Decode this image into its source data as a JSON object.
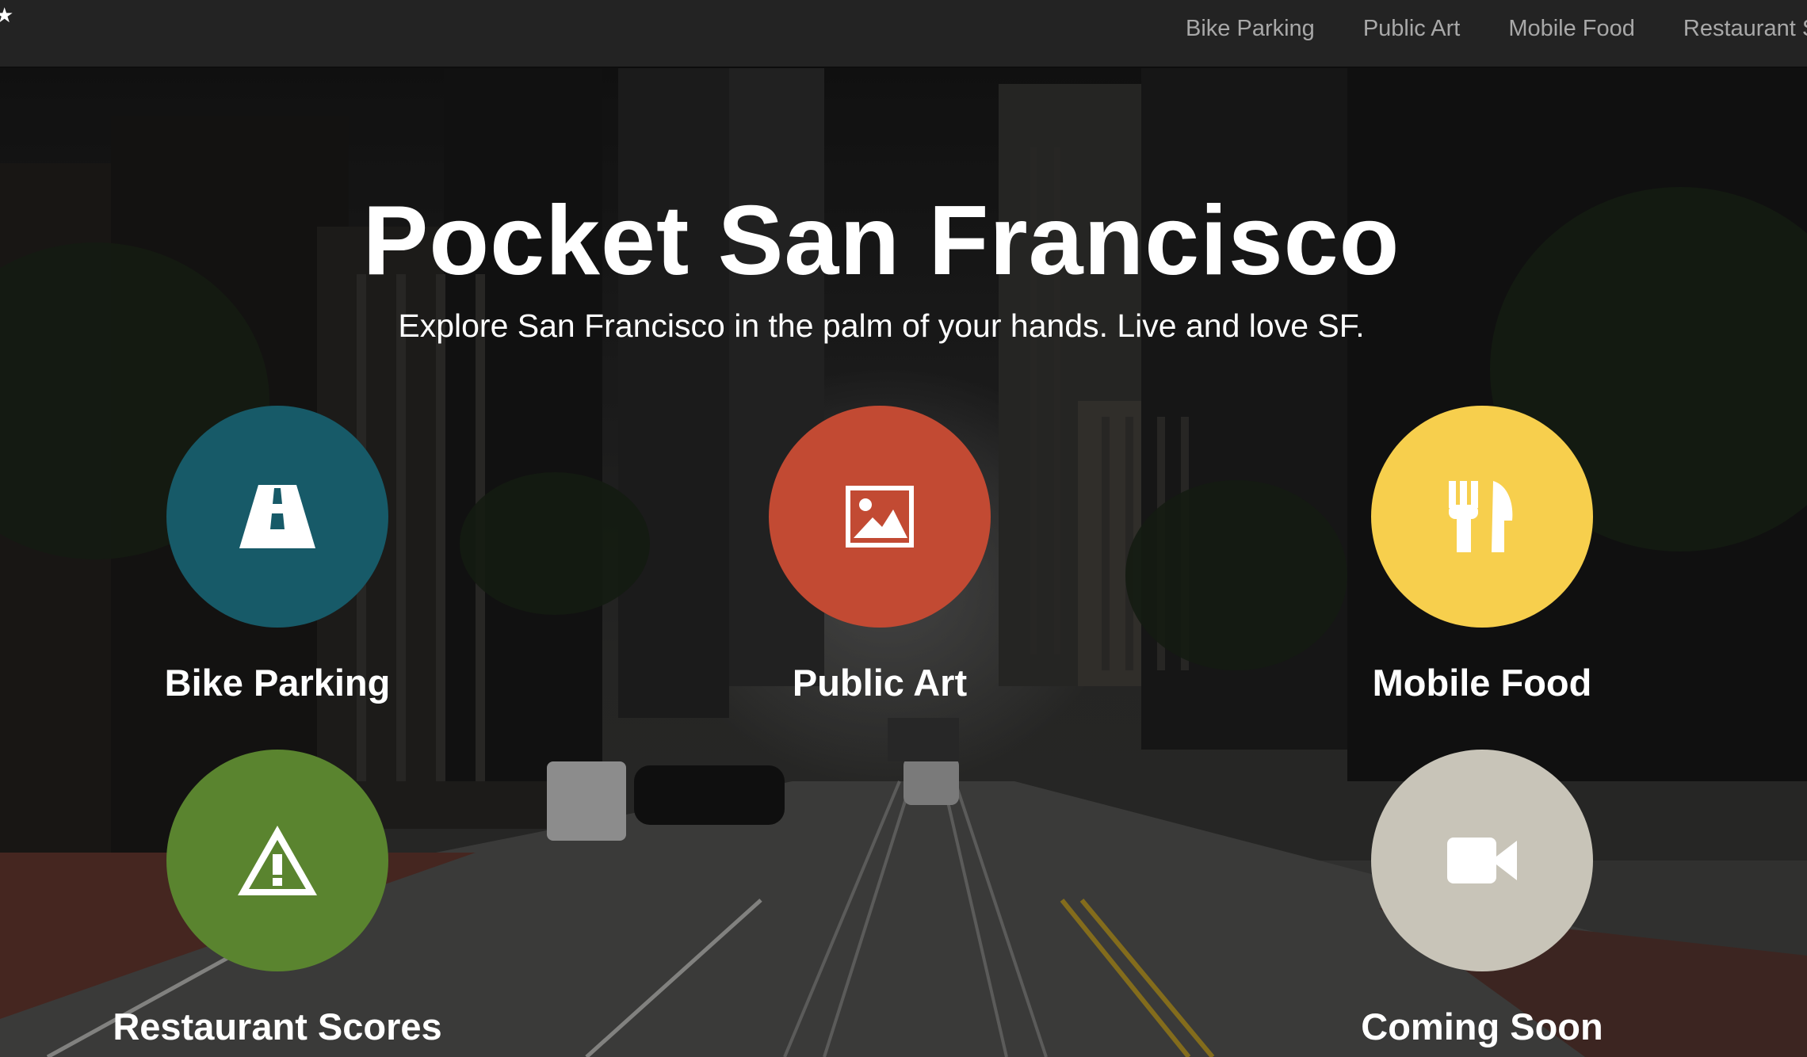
{
  "nav": {
    "links": [
      "Bike Parking",
      "Public Art",
      "Mobile Food",
      "Restaurant Scores"
    ]
  },
  "hero": {
    "title": "Pocket San Francisco",
    "subtitle": "Explore San Francisco in the palm of your hands. Live and love SF."
  },
  "tiles": [
    {
      "label": "Bike Parking",
      "color": "#175a68",
      "icon": "road-icon"
    },
    {
      "label": "Public Art",
      "color": "#c24a33",
      "icon": "image-icon"
    },
    {
      "label": "Mobile Food",
      "color": "#f7cf4d",
      "icon": "fork-knife-icon"
    },
    {
      "label": "Restaurant Scores",
      "color": "#5a842f",
      "icon": "warning-icon"
    },
    {
      "label": "Coming Soon",
      "color": "#c8c4b8",
      "icon": "video-camera-icon"
    }
  ]
}
